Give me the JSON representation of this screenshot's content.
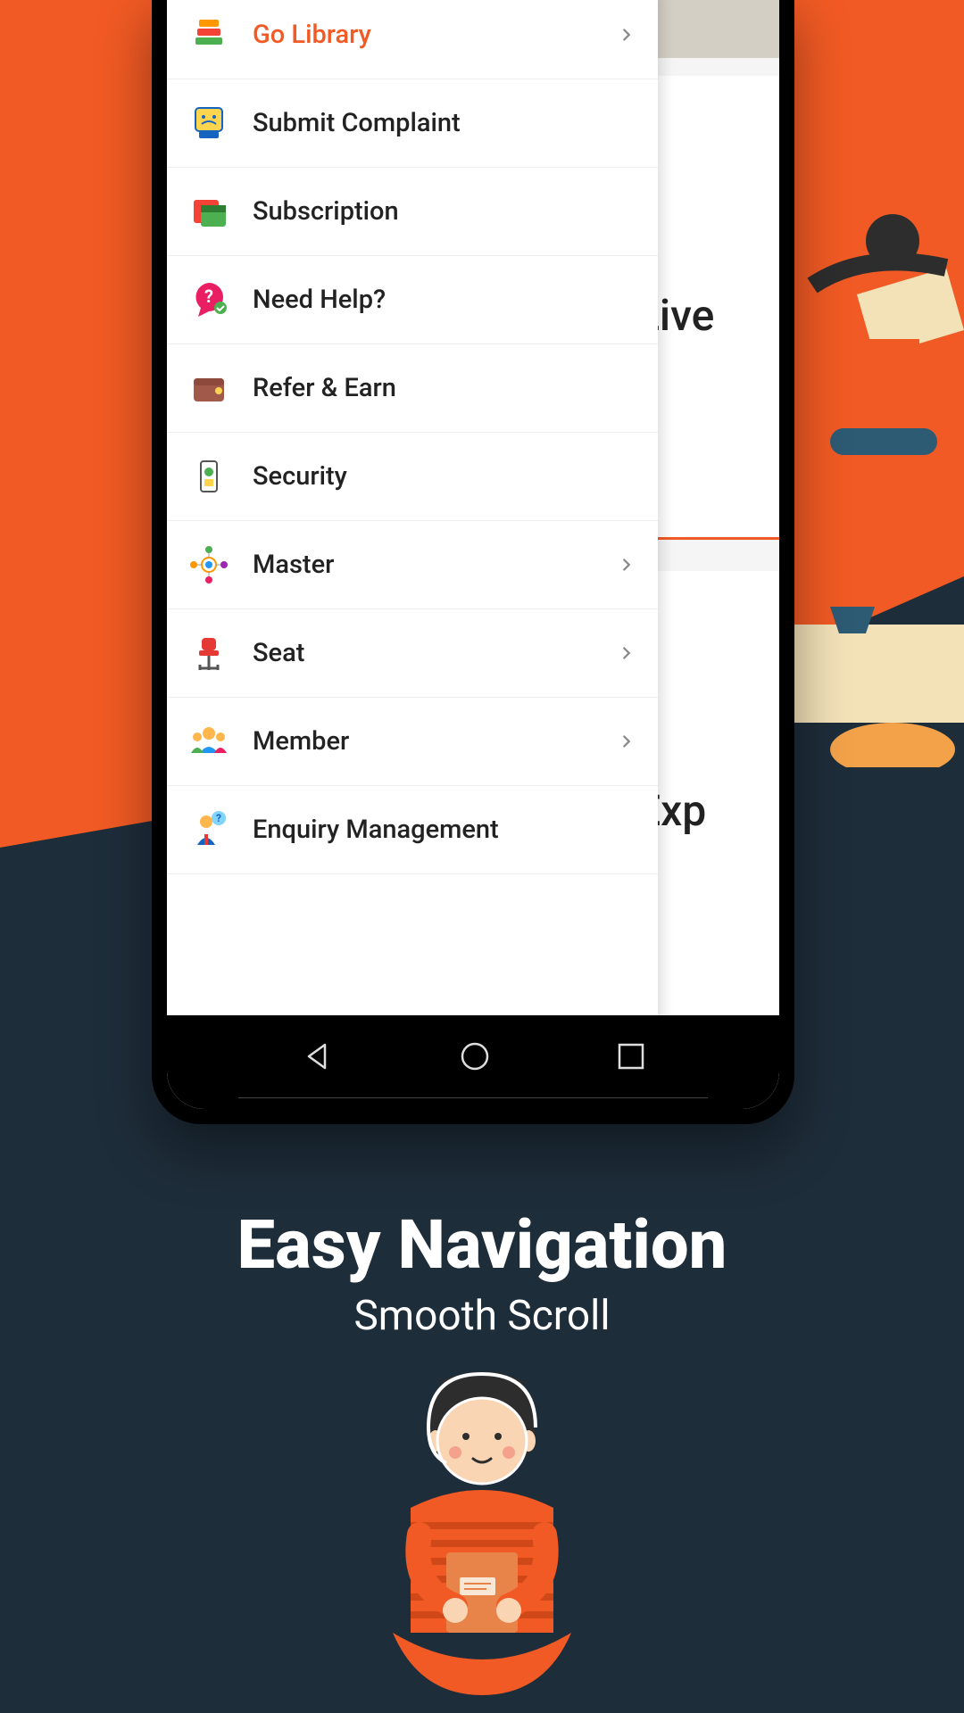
{
  "headline": {
    "title": "Easy Navigation",
    "subtitle": "Smooth Scroll"
  },
  "peek": {
    "card1": "Live",
    "card2": "Exp"
  },
  "menu": {
    "items": [
      {
        "label": "Go Library",
        "chevron": true,
        "active": true
      },
      {
        "label": "Submit Complaint",
        "chevron": false,
        "active": false
      },
      {
        "label": "Subscription",
        "chevron": false,
        "active": false
      },
      {
        "label": "Need Help?",
        "chevron": false,
        "active": false
      },
      {
        "label": "Refer & Earn",
        "chevron": false,
        "active": false
      },
      {
        "label": "Security",
        "chevron": false,
        "active": false
      },
      {
        "label": "Master",
        "chevron": true,
        "active": false
      },
      {
        "label": "Seat",
        "chevron": true,
        "active": false
      },
      {
        "label": "Member",
        "chevron": true,
        "active": false
      },
      {
        "label": "Enquiry Management",
        "chevron": false,
        "active": false
      }
    ]
  }
}
